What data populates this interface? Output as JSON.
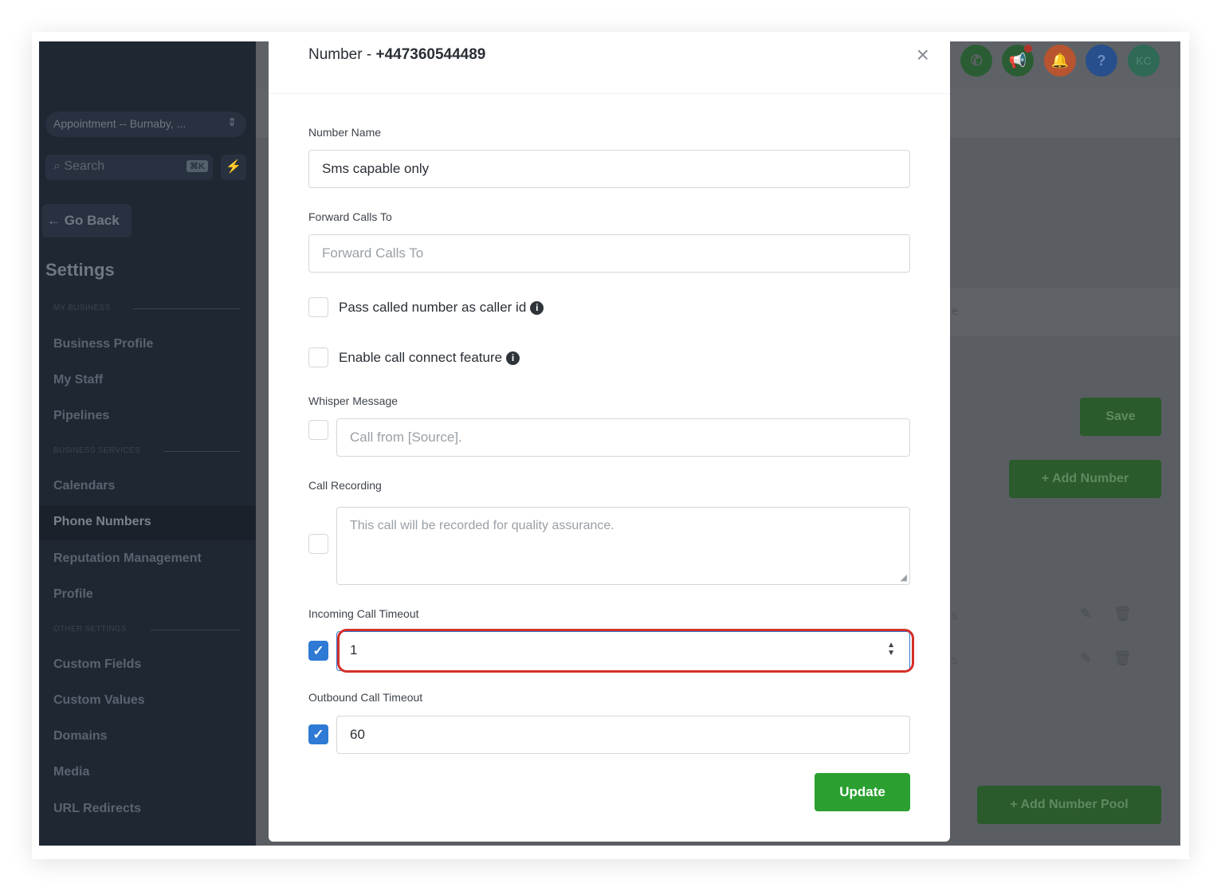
{
  "sidebar": {
    "location": "Appointment -- Burnaby, ...",
    "search_placeholder": "Search",
    "search_shortcut": "⌘K",
    "go_back": "Go Back",
    "title": "Settings",
    "sections": {
      "my_business": "MY BUSINESS",
      "business_services": "BUSINESS SERVICES",
      "other_settings": "OTHER SETTINGS"
    },
    "items": {
      "business_profile": "Business Profile",
      "my_staff": "My Staff",
      "pipelines": "Pipelines",
      "calendars": "Calendars",
      "phone_numbers": "Phone Numbers",
      "reputation_management": "Reputation Management",
      "profile": "Profile",
      "custom_fields": "Custom Fields",
      "custom_values": "Custom Values",
      "domains": "Domains",
      "media": "Media",
      "url_redirects": "URL Redirects"
    }
  },
  "header": {
    "avatar_initials": "KC",
    "help": "?"
  },
  "background": {
    "save_label": "Save",
    "add_number_label": "Add Number",
    "add_number_pool_label": "Add Number Pool",
    "fragment_e": "e",
    "fragment_s": "s"
  },
  "modal": {
    "title_prefix": "Number - ",
    "phone_number": "+447360544489",
    "close_symbol": "×",
    "number_name": {
      "label": "Number Name",
      "value": "Sms capable only"
    },
    "forward_calls": {
      "label": "Forward Calls To",
      "placeholder": "Forward Calls To"
    },
    "pass_called_number": {
      "label": "Pass called number as caller id",
      "checked": false
    },
    "enable_call_connect": {
      "label": "Enable call connect feature",
      "checked": false
    },
    "whisper_message": {
      "label": "Whisper Message",
      "placeholder": "Call from [Source].",
      "checked": false
    },
    "call_recording": {
      "label": "Call Recording",
      "placeholder": "This call will be recorded for quality assurance.",
      "checked": false
    },
    "incoming_timeout": {
      "label": "Incoming Call Timeout",
      "value": "1",
      "checked": true
    },
    "outbound_timeout": {
      "label": "Outbound Call Timeout",
      "value": "60",
      "checked": true
    },
    "update_label": "Update"
  },
  "colors": {
    "primary_green": "#2ba030",
    "checkbox_blue": "#2e7ad4",
    "highlight_red": "#d42f2a"
  }
}
